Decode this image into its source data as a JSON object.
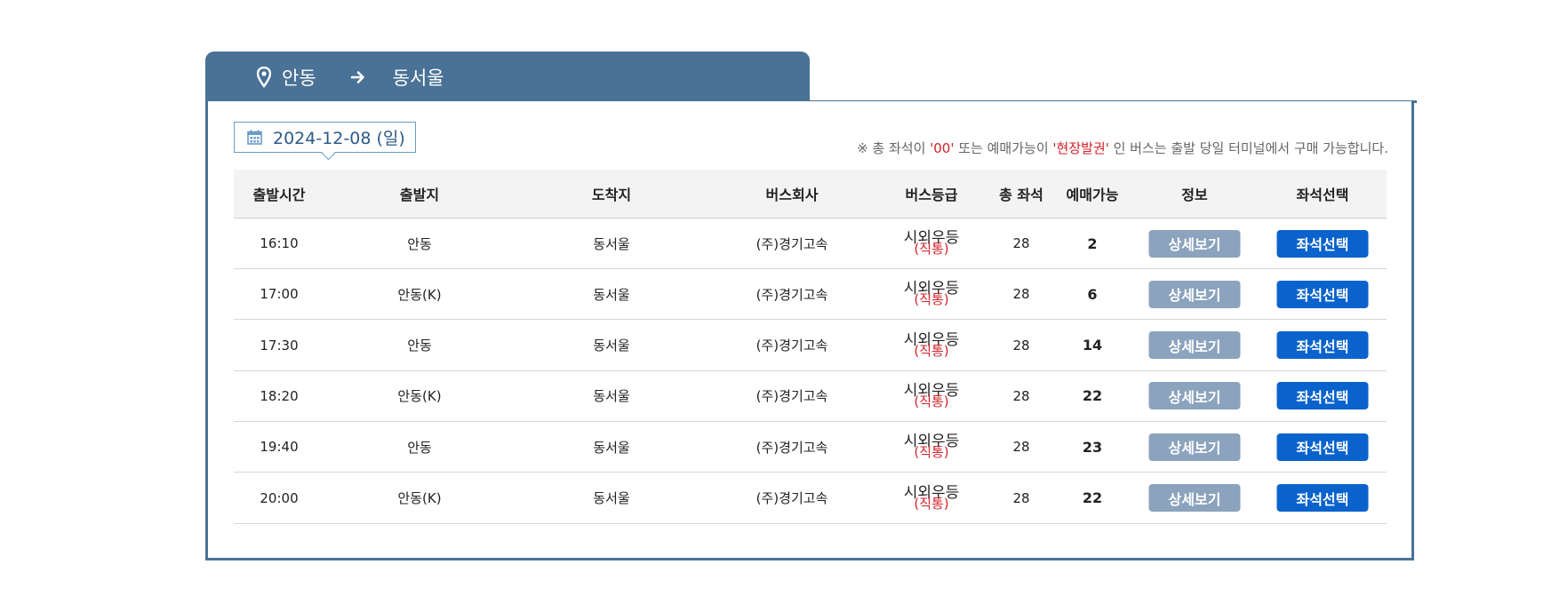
{
  "route": {
    "departure": "안동",
    "arrival": "동서울"
  },
  "date": "2024-12-08 (일)",
  "notice": {
    "part1": "※ 총 좌석이 ",
    "highlight1": "'00'",
    "part2": " 또는 예매가능이 ",
    "highlight2": "'현장발권'",
    "part3": " 인 버스는 출발 당일 터미널에서 구매 가능합니다."
  },
  "columns": {
    "time": "출발시간",
    "departure": "출발지",
    "arrival": "도착지",
    "company": "버스회사",
    "grade": "버스등급",
    "total_seats": "총 좌석",
    "available": "예매가능",
    "info": "정보",
    "seat_select": "좌석선택"
  },
  "rows": [
    {
      "time": "16:10",
      "departure": "안동",
      "arrival": "동서울",
      "company": "(주)경기고속",
      "grade": "시외우등",
      "grade_note": "(직통)",
      "total_seats": "28",
      "available": "2",
      "detail_label": "상세보기",
      "seat_label": "좌석선택"
    },
    {
      "time": "17:00",
      "departure": "안동(K)",
      "arrival": "동서울",
      "company": "(주)경기고속",
      "grade": "시외우등",
      "grade_note": "(직통)",
      "total_seats": "28",
      "available": "6",
      "detail_label": "상세보기",
      "seat_label": "좌석선택"
    },
    {
      "time": "17:30",
      "departure": "안동",
      "arrival": "동서울",
      "company": "(주)경기고속",
      "grade": "시외우등",
      "grade_note": "(직통)",
      "total_seats": "28",
      "available": "14",
      "detail_label": "상세보기",
      "seat_label": "좌석선택"
    },
    {
      "time": "18:20",
      "departure": "안동(K)",
      "arrival": "동서울",
      "company": "(주)경기고속",
      "grade": "시외우등",
      "grade_note": "(직통)",
      "total_seats": "28",
      "available": "22",
      "detail_label": "상세보기",
      "seat_label": "좌석선택"
    },
    {
      "time": "19:40",
      "departure": "안동",
      "arrival": "동서울",
      "company": "(주)경기고속",
      "grade": "시외우등",
      "grade_note": "(직통)",
      "total_seats": "28",
      "available": "23",
      "detail_label": "상세보기",
      "seat_label": "좌석선택"
    },
    {
      "time": "20:00",
      "departure": "안동(K)",
      "arrival": "동서울",
      "company": "(주)경기고속",
      "grade": "시외우등",
      "grade_note": "(직통)",
      "total_seats": "28",
      "available": "22",
      "detail_label": "상세보기",
      "seat_label": "좌석선택"
    }
  ],
  "icons": {
    "pin": "map-pin-icon",
    "arrow": "arrow-right-icon",
    "calendar": "calendar-icon"
  },
  "colors": {
    "header_blue": "#4a7296",
    "detail_button": "#8ba3bd",
    "seat_button": "#0a63cc",
    "highlight_red": "#d4212a"
  }
}
